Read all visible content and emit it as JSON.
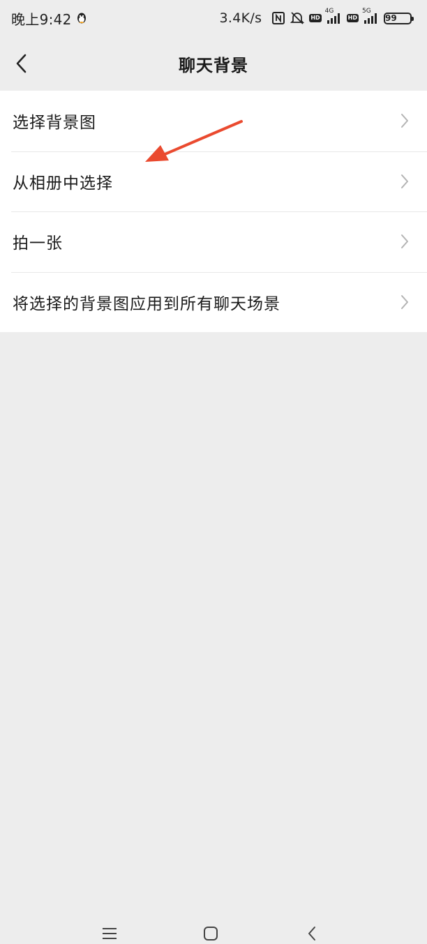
{
  "status_bar": {
    "time": "晚上9:42",
    "net_speed": "3.4K/s",
    "hd1": "HD",
    "net1": "4G",
    "hd2": "HD",
    "net2": "5G",
    "battery": "99"
  },
  "header": {
    "title": "聊天背景"
  },
  "menu": {
    "items": [
      {
        "label": "选择背景图"
      },
      {
        "label": "从相册中选择"
      },
      {
        "label": "拍一张"
      },
      {
        "label": "将选择的背景图应用到所有聊天场景"
      }
    ]
  },
  "colors": {
    "page_bg": "#ededed",
    "list_bg": "#ffffff",
    "annotation_arrow": "#ea4a2f"
  },
  "icons": {
    "back": "chevron-left-icon",
    "item_chevron": "chevron-right-icon",
    "nav_menu": "menu-lines-icon",
    "nav_home": "rounded-square-icon",
    "nav_back": "triangle-back-icon"
  }
}
